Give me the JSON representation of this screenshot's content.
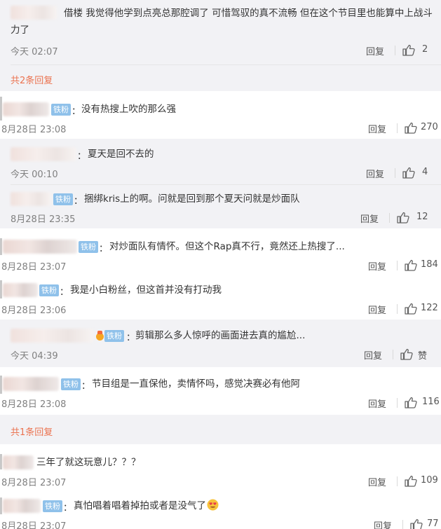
{
  "labels": {
    "reply": "回复",
    "badge_fan": "铁粉",
    "colon": "："
  },
  "icons": {
    "like": "thumbs-up-icon",
    "vip": "vip-crown-icon",
    "emoji": "heart-eyes-emoji"
  },
  "colors": {
    "link": "#eb7350",
    "badge": "#8fc1ea",
    "gray_bg": "#f2f2f5"
  },
  "comments": [
    {
      "text": "借楼 我觉得他学到点亮总那腔调了 可惜驾驭的真不流畅 但在这个节目里也能算中上战斗力了",
      "time": "今天 02:07",
      "likes": "2"
    },
    {
      "more": "共2条回复"
    },
    {
      "text": "没有热搜上吹的那么强",
      "time": "8月28日 23:08",
      "likes": "270"
    },
    {
      "text": "夏天是回不去的",
      "time": "今天 00:10",
      "likes": "4"
    },
    {
      "text": "捆绑kris上的啊。问就是回到那个夏天问就是炒面队",
      "time": "8月28日 23:35",
      "likes": "12"
    },
    {
      "text": "对炒面队有情怀。但这个Rap真不行，竟然还上热搜了...",
      "time": "8月28日 23:07",
      "likes": "184"
    },
    {
      "text": "我是小白粉丝，但这首并没有打动我",
      "time": "8月28日 23:06",
      "likes": "122"
    },
    {
      "text": "剪辑那么多人惊呼的画面进去真的尴尬...",
      "time": "今天 04:39",
      "likes": "赞"
    },
    {
      "text": "节目组是一直保他，卖情怀吗，感觉决赛必有他阿",
      "time": "8月28日 23:08",
      "likes": "116"
    },
    {
      "more": "共1条回复"
    },
    {
      "text": "三年了就这玩意儿？？？",
      "time": "8月28日 23:07",
      "likes": "109"
    },
    {
      "text": "真怕唱着唱着掉拍或者是没气了",
      "time": "8月28日 23:07",
      "likes": "77"
    }
  ]
}
